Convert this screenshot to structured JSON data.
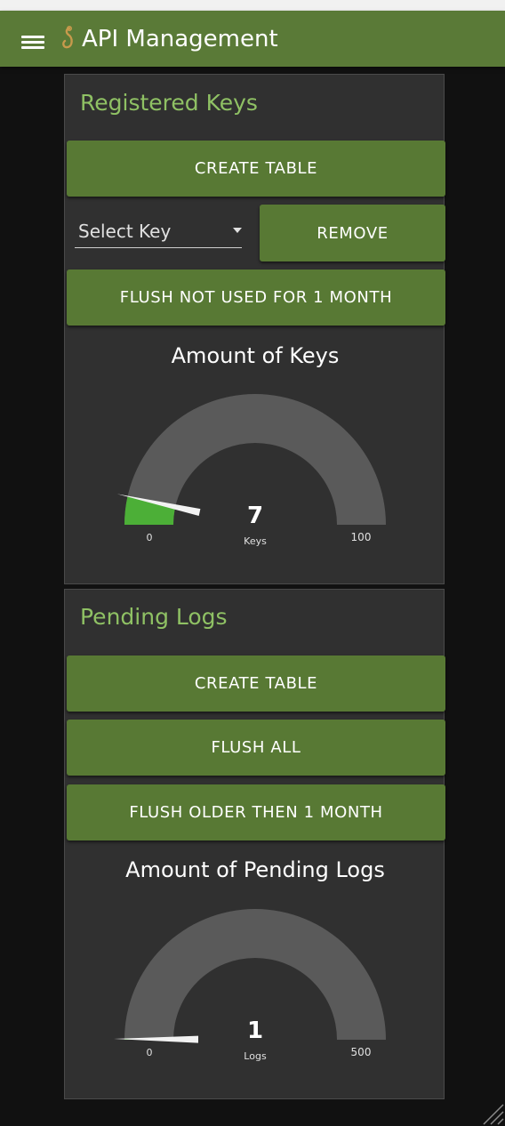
{
  "app": {
    "title": "API Management",
    "menu_icon": "hamburger-menu-icon",
    "logo_icon": "hook-icon",
    "accent_color": "#5a7a37"
  },
  "keys_card": {
    "title": "Registered Keys",
    "create_table_label": "CREATE TABLE",
    "select": {
      "placeholder": "Select Key"
    },
    "remove_label": "REMOVE",
    "flush_label": "FLUSH NOT USED FOR 1 MONTH",
    "gauge": {
      "title": "Amount of Keys",
      "value": 7,
      "value_text": "7",
      "unit": "Keys",
      "min": 0,
      "max": 100,
      "min_label": "0",
      "max_label": "100",
      "fill_color": "#4caf37"
    }
  },
  "logs_card": {
    "title": "Pending Logs",
    "create_table_label": "CREATE TABLE",
    "flush_all_label": "FLUSH ALL",
    "flush_older_label": "FLUSH OLDER THEN 1 MONTH",
    "gauge": {
      "title": "Amount of Pending Logs",
      "value": 1,
      "value_text": "1",
      "unit": "Logs",
      "min": 0,
      "max": 500,
      "min_label": "0",
      "max_label": "500",
      "fill_color": "#4caf37"
    }
  }
}
